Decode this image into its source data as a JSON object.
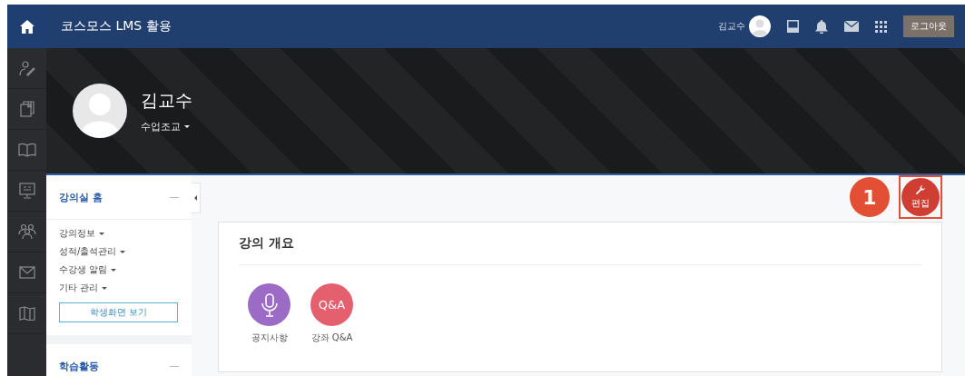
{
  "topbar": {
    "title": "코스모스 LMS 활용",
    "user_name": "김교수",
    "logout": "로그아웃"
  },
  "rail": [
    {
      "kind": "person-pen"
    },
    {
      "kind": "book-stack"
    },
    {
      "kind": "book-open"
    },
    {
      "kind": "board"
    },
    {
      "kind": "people"
    },
    {
      "kind": "mail"
    },
    {
      "kind": "map"
    }
  ],
  "profile": {
    "name": "김교수",
    "role": "수업조교"
  },
  "edit_button": {
    "label": "편집",
    "callout": "1"
  },
  "sidebar": {
    "sections": [
      {
        "title": "강의실 홈",
        "items": [
          "강의정보",
          "성적/출석관리",
          "수강생 알림",
          "기타 관리"
        ],
        "button": "학생화면 보기"
      },
      {
        "title": "학습활동"
      }
    ]
  },
  "course": {
    "title": "강의 개요",
    "activities": [
      {
        "kind": "mic",
        "color": "#9b6bc6",
        "label": "공지사항"
      },
      {
        "kind": "qa",
        "color": "#e5606f",
        "icon_text": "Q&A",
        "label": "강좌 Q&A"
      }
    ]
  }
}
